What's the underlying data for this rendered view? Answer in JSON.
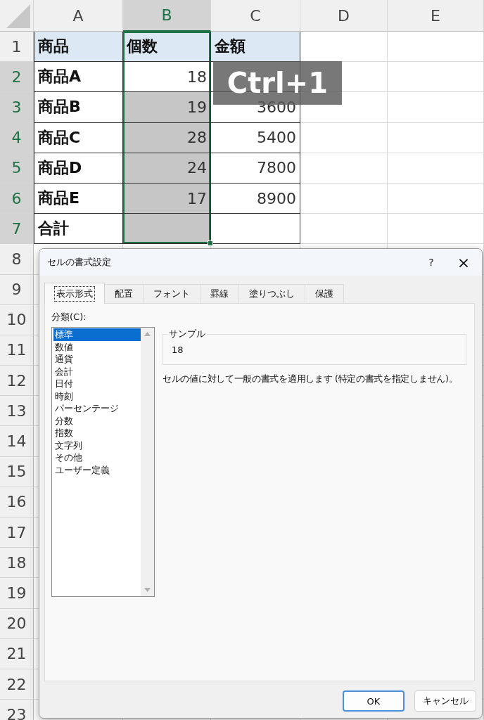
{
  "sheet": {
    "columns": [
      {
        "label": "A",
        "selected": false
      },
      {
        "label": "B",
        "selected": true
      },
      {
        "label": "C",
        "selected": false
      },
      {
        "label": "D",
        "selected": false
      },
      {
        "label": "E",
        "selected": false
      }
    ],
    "rows": [
      {
        "label": "1",
        "selected": false,
        "kind": "header",
        "cells": [
          {
            "text": "商品",
            "kind": "text",
            "selected": false
          },
          {
            "text": "個数",
            "kind": "text",
            "selected": false
          },
          {
            "text": "金額",
            "kind": "text",
            "selected": false
          }
        ]
      },
      {
        "label": "2",
        "selected": true,
        "kind": "data",
        "cells": [
          {
            "text": "商品A",
            "kind": "text",
            "selected": false
          },
          {
            "text": "18",
            "kind": "number",
            "selected": false
          },
          {
            "kind": "number",
            "selected": false
          }
        ]
      },
      {
        "label": "3",
        "selected": true,
        "kind": "data",
        "cells": [
          {
            "text": "商品B",
            "kind": "text",
            "selected": false
          },
          {
            "text": "19",
            "kind": "number",
            "selected": true
          },
          {
            "text": "3600",
            "kind": "number",
            "selected": false
          }
        ]
      },
      {
        "label": "4",
        "selected": true,
        "kind": "data",
        "cells": [
          {
            "text": "商品C",
            "kind": "text",
            "selected": false
          },
          {
            "text": "28",
            "kind": "number",
            "selected": true
          },
          {
            "text": "5400",
            "kind": "number",
            "selected": false
          }
        ]
      },
      {
        "label": "5",
        "selected": true,
        "kind": "data",
        "cells": [
          {
            "text": "商品D",
            "kind": "text",
            "selected": false
          },
          {
            "text": "24",
            "kind": "number",
            "selected": true
          },
          {
            "text": "7800",
            "kind": "number",
            "selected": false
          }
        ]
      },
      {
        "label": "6",
        "selected": true,
        "kind": "data",
        "cells": [
          {
            "text": "商品E",
            "kind": "text",
            "selected": false
          },
          {
            "text": "17",
            "kind": "number",
            "selected": true
          },
          {
            "text": "8900",
            "kind": "number",
            "selected": false
          }
        ]
      },
      {
        "label": "7",
        "selected": true,
        "kind": "data",
        "cells": [
          {
            "text": "合計",
            "kind": "text",
            "selected": false
          },
          {
            "kind": "number",
            "selected": true
          },
          {
            "kind": "number",
            "selected": false
          }
        ]
      },
      {
        "label": "8",
        "selected": false
      },
      {
        "label": "9",
        "selected": false
      },
      {
        "label": "10",
        "selected": false
      },
      {
        "label": "11",
        "selected": false
      },
      {
        "label": "12",
        "selected": false
      },
      {
        "label": "13",
        "selected": false
      },
      {
        "label": "14",
        "selected": false
      },
      {
        "label": "15",
        "selected": false
      },
      {
        "label": "16",
        "selected": false
      },
      {
        "label": "17",
        "selected": false
      },
      {
        "label": "18",
        "selected": false
      },
      {
        "label": "19",
        "selected": false
      },
      {
        "label": "20",
        "selected": false
      },
      {
        "label": "21",
        "selected": false
      },
      {
        "label": "22",
        "selected": false
      },
      {
        "label": "23",
        "selected": false
      }
    ]
  },
  "shortcut_overlay": {
    "text": "Ctrl+1"
  },
  "dialog": {
    "title": "セルの書式設定",
    "help": "?",
    "close": "×",
    "tabs": [
      {
        "label": "表示形式",
        "selected": true
      },
      {
        "label": "配置",
        "selected": false
      },
      {
        "label": "フォント",
        "selected": false
      },
      {
        "label": "罫線",
        "selected": false
      },
      {
        "label": "塗りつぶし",
        "selected": false
      },
      {
        "label": "保護",
        "selected": false
      }
    ],
    "category_label": "分類(C):",
    "categories": [
      {
        "label": "標準",
        "selected": true
      },
      {
        "label": "数値",
        "selected": false
      },
      {
        "label": "通貨",
        "selected": false
      },
      {
        "label": "会計",
        "selected": false
      },
      {
        "label": "日付",
        "selected": false
      },
      {
        "label": "時刻",
        "selected": false
      },
      {
        "label": "パーセンテージ",
        "selected": false
      },
      {
        "label": "分数",
        "selected": false
      },
      {
        "label": "指数",
        "selected": false
      },
      {
        "label": "文字列",
        "selected": false
      },
      {
        "label": "その他",
        "selected": false
      },
      {
        "label": "ユーザー定義",
        "selected": false
      }
    ],
    "sample": {
      "label": "サンプル",
      "value": "18"
    },
    "description": "セルの値に対して一般の書式を適用します (特定の書式を指定しません)。",
    "buttons": [
      {
        "label": "OK",
        "default": true
      },
      {
        "label": "キャンセル",
        "default": false
      }
    ]
  }
}
